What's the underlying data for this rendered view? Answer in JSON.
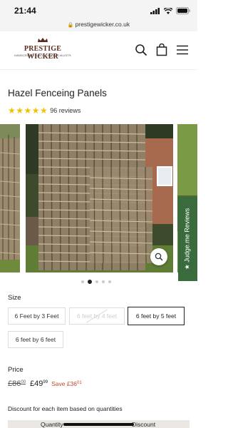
{
  "status_bar": {
    "time": "21:44",
    "url": "prestigewicker.co.uk",
    "icons": [
      "signal-icon",
      "wifi-icon",
      "battery-icon"
    ]
  },
  "header": {
    "logo_title": "PRESTIGE WICKER",
    "logo_subtitle": "HANDCRAFTED WILLOW SPECIALISTS",
    "icons": [
      "search-icon",
      "cart-icon",
      "menu-icon"
    ]
  },
  "product": {
    "title": "Hazel Fenceing Panels",
    "stars": "★★★★★",
    "reviews": "96 reviews",
    "rating_value": 5
  },
  "gallery": {
    "dots_count": 5,
    "active_dot": 1,
    "judgeme_label": "★ Judge.me Reviews"
  },
  "size": {
    "label": "Size",
    "options": [
      {
        "label": "6 Feet by 3 Feet",
        "state": "available"
      },
      {
        "label": "6 feet by 4 feet",
        "state": "unavailable"
      },
      {
        "label": "6 feet by 5 feet",
        "state": "selected"
      },
      {
        "label": "6 feet by 6 feet",
        "state": "available"
      }
    ]
  },
  "price": {
    "label": "Price",
    "old_main": "£86",
    "old_pence": "00",
    "new_main": "£49",
    "new_pence": "99",
    "save_main": "Save £36",
    "save_pence": "01"
  },
  "discount": {
    "text": "Discount for each item based on quantities",
    "col_quantity": "Quantity",
    "col_discount": "Discount"
  },
  "colors": {
    "brand": "#5a2b1d",
    "star": "#f2c200",
    "save": "#c24a2a",
    "judgeme": "#3a6b3c"
  }
}
